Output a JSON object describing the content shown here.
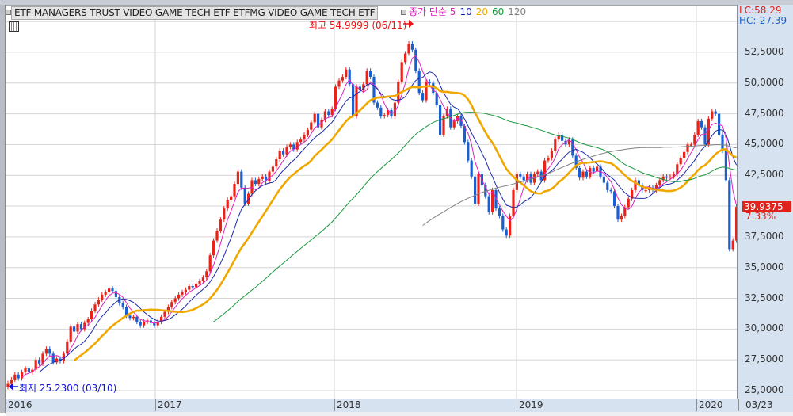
{
  "header": {
    "title": "ETF MANAGERS TRUST VIDEO GAME TECH ETF  ETFMG VIDEO GAME TECH ETF",
    "legend": [
      {
        "label": "종가 단순 5",
        "color": "#e020c0"
      },
      {
        "label": "10",
        "color": "#1c2aa8"
      },
      {
        "label": "20",
        "color": "#f0a800"
      },
      {
        "label": "60",
        "color": "#18983a"
      },
      {
        "label": "120",
        "color": "#808080"
      }
    ]
  },
  "right_panel": {
    "lc": "LC:58.29",
    "hc": "HC:-27.39",
    "current_price": "39.9375",
    "change_pct": "7.33%",
    "ticks": [
      "52,5000",
      "50,0000",
      "47,5000",
      "45,0000",
      "42,5000",
      "40,0000",
      "37,5000",
      "35,0000",
      "32,5000",
      "30,0000",
      "27,5000",
      "25,0000"
    ]
  },
  "x_axis": {
    "labels": [
      "2016",
      "2017",
      "2018",
      "2019",
      "2020",
      "03/23"
    ]
  },
  "annotations": {
    "high": "최고 54.9999 (06/11)",
    "low": "최저 25.2300 (03/10)"
  },
  "colors": {
    "up": "#e8231a",
    "down": "#1a5fd0"
  },
  "chart_data": {
    "type": "candlestick",
    "interval": "weekly",
    "y_range": [
      25,
      55
    ],
    "grid": true,
    "moving_averages": [
      5,
      10,
      20,
      60,
      120
    ],
    "x_tick_labels": [
      "2016",
      "2017",
      "2018",
      "2019",
      "2020"
    ],
    "high": 54.9999,
    "low": 25.23,
    "close": [
      25.6,
      25.9,
      26.3,
      26.0,
      26.5,
      26.8,
      26.5,
      26.7,
      27.5,
      27.2,
      28.0,
      28.4,
      28.0,
      27.3,
      27.6,
      27.4,
      28.0,
      29.0,
      30.2,
      29.8,
      30.4,
      30.0,
      30.5,
      30.8,
      31.5,
      32.0,
      32.4,
      32.8,
      33.0,
      33.3,
      33.1,
      32.6,
      32.1,
      31.8,
      31.1,
      30.9,
      31.0,
      30.6,
      30.3,
      30.6,
      30.7,
      30.5,
      30.3,
      30.6,
      31.0,
      31.4,
      31.8,
      32.2,
      32.5,
      32.8,
      33.0,
      33.2,
      33.5,
      33.4,
      33.7,
      33.9,
      34.2,
      34.7,
      36.0,
      37.2,
      38.0,
      38.9,
      39.8,
      40.5,
      40.8,
      41.8,
      42.8,
      41.5,
      40.2,
      41.0,
      42.1,
      41.8,
      42.2,
      42.4,
      42.0,
      42.8,
      43.2,
      43.8,
      44.5,
      44.2,
      44.8,
      45.0,
      44.6,
      45.2,
      45.4,
      45.8,
      46.2,
      46.8,
      47.5,
      46.4,
      47.0,
      47.7,
      47.4,
      47.9,
      49.7,
      50.2,
      50.5,
      51.1,
      49.9,
      47.3,
      49.7,
      49.4,
      49.9,
      51.0,
      50.5,
      48.4,
      48.0,
      47.3,
      47.4,
      47.8,
      47.3,
      48.4,
      50.1,
      51.7,
      52.4,
      53.2,
      52.7,
      51.0,
      49.2,
      48.6,
      50.1,
      50.0,
      49.2,
      48.2,
      45.8,
      47.3,
      47.9,
      46.4,
      46.9,
      47.3,
      46.5,
      45.2,
      43.7,
      42.4,
      40.2,
      42.6,
      41.7,
      40.8,
      39.5,
      41.3,
      39.8,
      39.2,
      38.1,
      37.6,
      39.2,
      41.3,
      42.6,
      42.4,
      42.1,
      42.6,
      41.9,
      42.6,
      42.8,
      42.1,
      43.7,
      43.9,
      44.5,
      45.4,
      45.8,
      45.3,
      45.0,
      45.4,
      44.1,
      43.1,
      42.3,
      42.8,
      42.4,
      43.1,
      42.8,
      43.2,
      42.4,
      41.9,
      41.3,
      41.2,
      40.0,
      38.9,
      39.2,
      39.9,
      40.6,
      41.3,
      42.1,
      41.7,
      41.3,
      41.3,
      41.5,
      41.3,
      41.7,
      42.1,
      42.4,
      42.3,
      42.4,
      42.6,
      43.4,
      43.9,
      44.4,
      45.0,
      45.0,
      45.8,
      46.9,
      46.4,
      45.0,
      47.1,
      47.7,
      47.5,
      45.8,
      44.5,
      42.1,
      36.5,
      37.2,
      39.9375
    ]
  }
}
